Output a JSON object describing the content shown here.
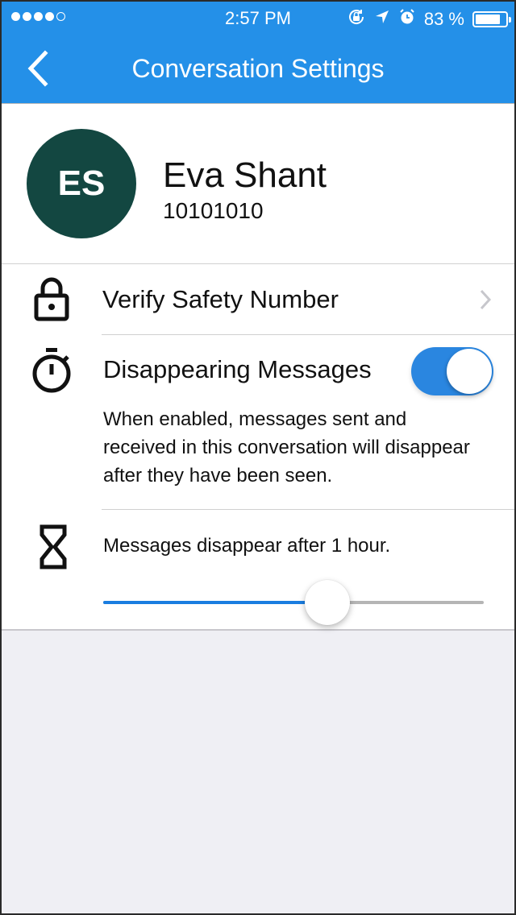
{
  "status_bar": {
    "signal_strength": {
      "filled": 4,
      "total": 5
    },
    "time": "2:57 PM",
    "icons": [
      "rotation-lock-icon",
      "location-arrow-icon",
      "alarm-icon"
    ],
    "battery_percent_label": "83 %",
    "battery_level": 0.83
  },
  "nav": {
    "back_icon": "chevron-left-icon",
    "title": "Conversation Settings"
  },
  "profile": {
    "initials": "ES",
    "name": "Eva Shant",
    "number": "10101010",
    "avatar_color": "#134741"
  },
  "rows": {
    "verify": {
      "icon": "lock-icon",
      "label": "Verify Safety Number",
      "accessory": "chevron-right-icon"
    },
    "disappearing": {
      "icon": "stopwatch-icon",
      "label": "Disappearing Messages",
      "enabled": true,
      "description": "When enabled, messages sent and received in this conversation will disappear after they have been seen."
    },
    "timer": {
      "icon": "hourglass-icon",
      "label": "Messages disappear after 1 hour.",
      "slider_value": 0.59
    }
  },
  "colors": {
    "header": "#2490e8",
    "toggle_on": "#2a86e0",
    "slider_fill": "#1a7de0",
    "background": "#efeff4"
  }
}
